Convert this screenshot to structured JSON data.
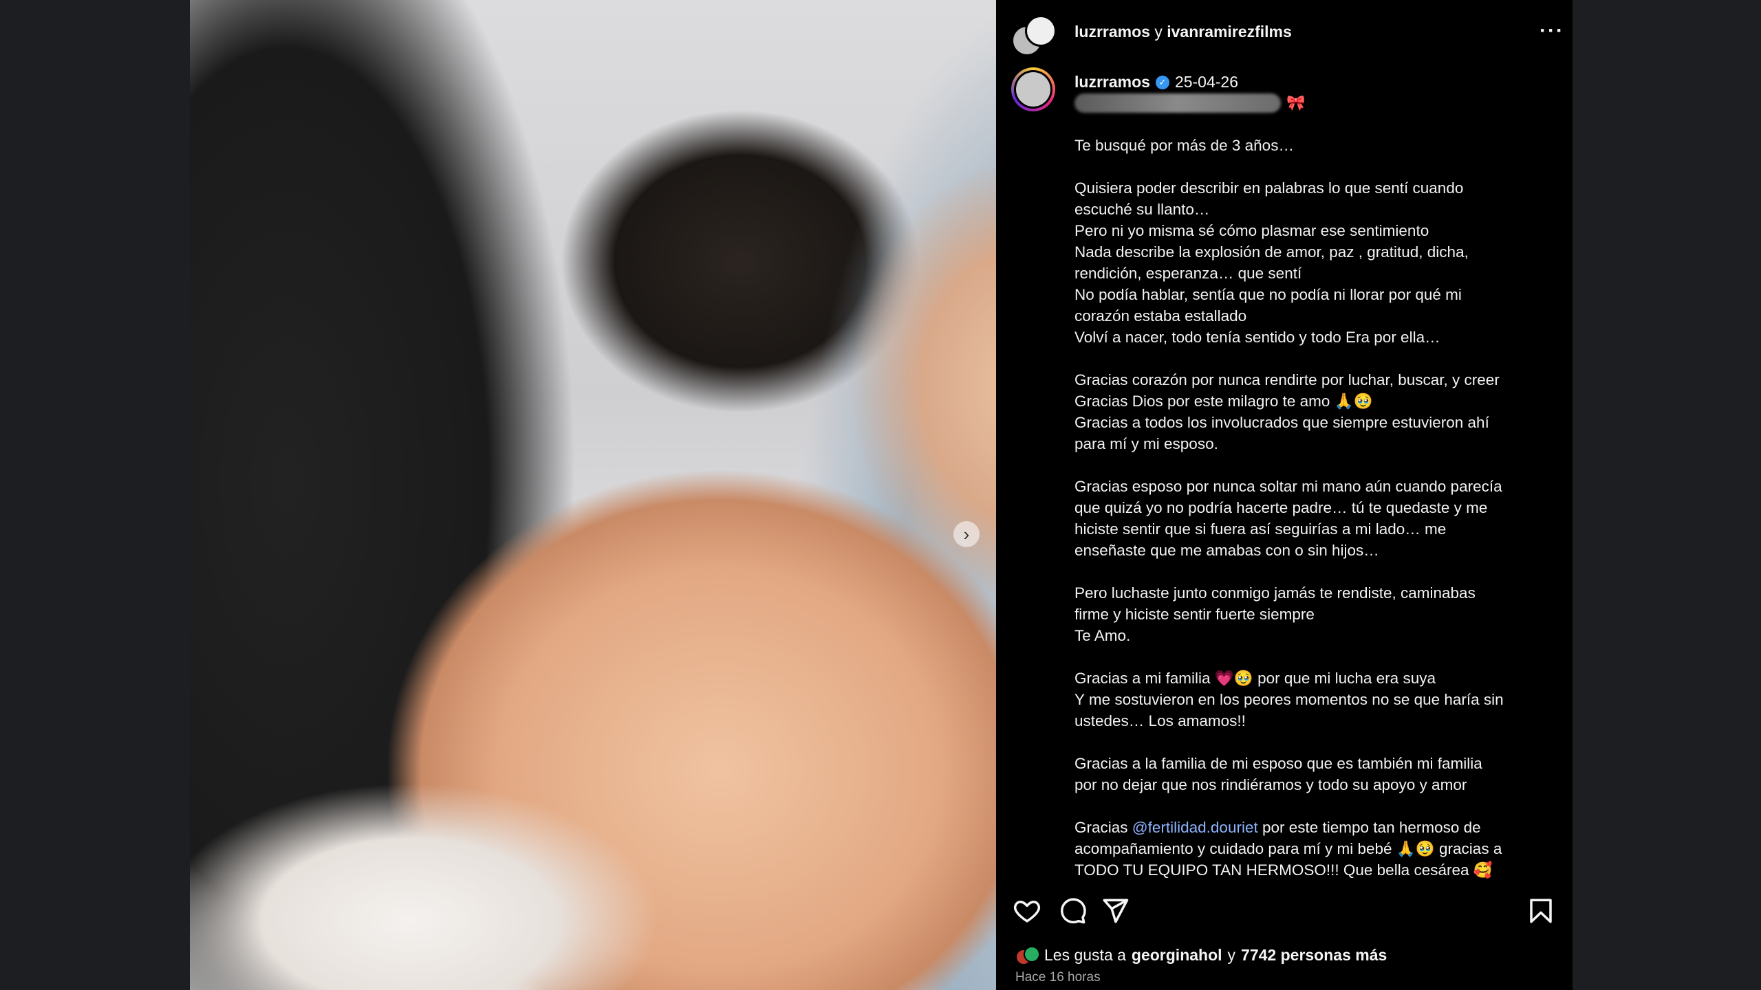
{
  "header": {
    "user1": "luzrramos",
    "joiner": "y",
    "user2": "ivanramirezfilms"
  },
  "icons": {
    "more": "more-horizontal-icon",
    "verified": "verified-badge-icon",
    "next": "chevron-right-icon",
    "like": "heart-icon",
    "comment": "comment-icon",
    "share": "send-icon",
    "save": "bookmark-icon",
    "bow": "ribbon-icon"
  },
  "author": {
    "username": "luzrramos",
    "date": "25-04-26",
    "bow": "🎀"
  },
  "caption": {
    "intro": "Te busqué por más de 3 años…\n\nQuisiera poder describir en palabras lo que sentí cuando\nescuché su llanto…\nPero ni yo misma sé cómo plasmar ese sentimiento\nNada describe la explosión de amor, paz , gratitud, dicha,\nrendición, esperanza… que sentí\nNo podía hablar, sentía que no podía ni llorar por qué mi\ncorazón estaba estallado\nVolví a nacer, todo tenía sentido y todo Era por ella…\n\nGracias corazón por nunca rendirte por luchar, buscar, y creer\nGracias Dios por este milagro te amo 🙏🥹\nGracias a todos los involucrados que siempre estuvieron ahí\npara mí y mi esposo.\n\nGracias esposo por nunca soltar mi mano aún cuando parecía\nque quizá yo no podría hacerte padre… tú te quedaste y me\nhiciste sentir que si fuera así seguirías a mi lado… me\nenseñaste que me amabas con o sin hijos…\n\nPero luchaste junto conmigo jamás te rendiste, caminabas\nfirme y hiciste sentir fuerte siempre\nTe Amo.\n\nGracias a mi familia 💗🥹 por que mi lucha era suya\nY me sostuvieron en los peores momentos no se que haría sin\nustedes… Los amamos!!\n\nGracias a la familia de mi esposo que es también mi familia\npor no dejar que nos rindiéramos y todo su apoyo y amor\n\nGracias ",
    "mention": "@fertilidad.douriet",
    "outro": " por este tiempo tan hermoso de\nacompañamiento y cuidado para mí y mi bebé 🙏🥹 gracias a\nTODO TU EQUIPO TAN HERMOSO!!! Que bella cesárea 🥰"
  },
  "likes": {
    "prefix": "Les gusta a",
    "user": "georginahol",
    "joiner": "y",
    "others": "7742 personas más"
  },
  "time": "Hace 16 horas",
  "colors": {
    "background": "#1d1e22",
    "panel": "#000000",
    "mention": "#8fb4ff",
    "verified": "#3897f0"
  }
}
